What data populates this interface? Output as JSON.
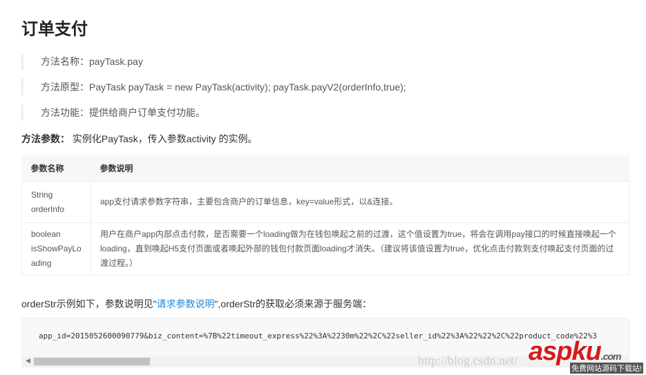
{
  "title": "订单支付",
  "quotes": [
    "方法名称：payTask.pay",
    "方法原型：PayTask payTask = new PayTask(activity); payTask.payV2(orderInfo,true);",
    "方法功能：提供给商户订单支付功能。"
  ],
  "params": {
    "label": "方法参数：",
    "text": " 实例化PayTask，传入参数activity 的实例。"
  },
  "table": {
    "headers": [
      "参数名称",
      "参数说明"
    ],
    "rows": [
      {
        "name": [
          "String",
          "orderInfo"
        ],
        "desc": "app支付请求参数字符串，主要包含商户的订单信息，key=value形式，以&连接。"
      },
      {
        "name": [
          "boolean",
          "isShowPayLo",
          "ading"
        ],
        "desc": "用户在商户app内部点击付款，是否需要一个loading做为在钱包唤起之前的过渡，这个值设置为true，将会在调用pay接口的时候直接唤起一个loading，直到唤起H5支付页面或者唤起外部的钱包付款页面loading才消失。（建议将该值设置为true，优化点击付款到支付唤起支付页面的过渡过程。）"
      }
    ]
  },
  "example": {
    "pre": "orderStr示例如下，参数说明见\"",
    "link": "请求参数说明",
    "post": "\",orderStr的获取必须来源于服务端："
  },
  "code": "app_id=2015052600090779&biz_content=%7B%22timeout_express%22%3A%2230m%22%2C%22seller_id%22%3A%22%22%2C%22product_code%22%3",
  "watermark": "http://blog.csdn.net/",
  "logo": {
    "main": "aspku",
    "tld": ".com",
    "sub": "免费网站源码下载站!"
  }
}
